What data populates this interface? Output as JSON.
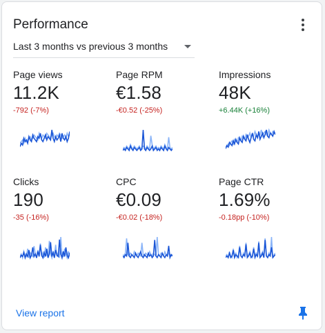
{
  "card": {
    "title": "Performance",
    "date_range": "Last 3 months vs previous 3 months",
    "footer_link": "View report",
    "icons": {
      "menu": "more-vert-icon",
      "dropdown": "arrow-drop-down-icon",
      "pin": "pin-icon"
    }
  },
  "colors": {
    "accent": "#1a73e8",
    "line_current": "#1a55d6",
    "line_previous": "#8ab4f8",
    "negative": "#c5221f",
    "positive": "#188038"
  },
  "metrics": [
    {
      "name": "Page views",
      "value": "11.2K",
      "change": "-792 (-7%)",
      "trend": "negative",
      "spark": {
        "current": [
          4,
          6,
          5,
          9,
          7,
          8,
          6,
          10,
          8,
          7,
          11,
          9,
          8,
          7,
          10,
          9,
          12,
          8,
          7,
          9,
          11,
          8,
          10,
          9,
          8,
          14,
          9,
          7,
          10,
          8,
          9,
          11,
          7,
          12,
          9,
          8,
          10,
          7,
          9,
          13
        ],
        "previous": [
          6,
          7,
          8,
          6,
          9,
          7,
          8,
          9,
          10,
          8,
          9,
          11,
          10,
          9,
          8,
          12,
          10,
          9,
          11,
          10,
          9,
          12,
          11,
          10,
          9,
          11,
          12,
          10,
          9,
          11,
          10,
          12,
          11,
          9,
          10,
          11,
          9,
          12,
          10,
          11
        ]
      }
    },
    {
      "name": "Page RPM",
      "value": "€1.58",
      "change": "-€0.52 (-25%)",
      "trend": "negative",
      "spark": {
        "current": [
          2,
          3,
          2,
          4,
          3,
          2,
          5,
          3,
          2,
          4,
          3,
          2,
          3,
          4,
          2,
          3,
          16,
          3,
          2,
          4,
          3,
          2,
          3,
          5,
          2,
          3,
          4,
          2,
          3,
          2,
          4,
          3,
          2,
          5,
          3,
          2,
          4,
          3,
          2,
          3
        ],
        "previous": [
          3,
          4,
          3,
          5,
          4,
          3,
          6,
          4,
          3,
          5,
          4,
          3,
          4,
          5,
          3,
          4,
          5,
          4,
          3,
          5,
          4,
          3,
          12,
          6,
          3,
          4,
          5,
          3,
          4,
          3,
          5,
          4,
          3,
          6,
          4,
          3,
          11,
          4,
          3,
          4
        ]
      }
    },
    {
      "name": "Impressions",
      "value": "48K",
      "change": "+6.44K (+16%)",
      "trend": "positive",
      "spark": {
        "current": [
          3,
          5,
          4,
          7,
          6,
          5,
          8,
          6,
          9,
          7,
          6,
          10,
          8,
          7,
          11,
          9,
          8,
          12,
          9,
          7,
          10,
          13,
          9,
          8,
          12,
          10,
          14,
          9,
          11,
          13,
          10,
          12,
          15,
          11,
          10,
          13,
          12,
          11,
          14,
          12
        ],
        "previous": [
          4,
          5,
          6,
          5,
          7,
          8,
          6,
          9,
          8,
          7,
          10,
          9,
          8,
          11,
          10,
          9,
          12,
          10,
          11,
          13,
          10,
          12,
          11,
          14,
          12,
          10,
          13,
          12,
          15,
          11,
          13,
          14,
          12,
          11,
          15,
          13,
          12,
          14,
          13,
          12
        ]
      }
    },
    {
      "name": "Clicks",
      "value": "190",
      "change": "-35 (-16%)",
      "trend": "negative",
      "spark": {
        "current": [
          2,
          4,
          3,
          6,
          2,
          5,
          3,
          8,
          2,
          4,
          10,
          3,
          5,
          2,
          7,
          3,
          12,
          4,
          2,
          6,
          3,
          9,
          2,
          5,
          14,
          3,
          6,
          2,
          8,
          4,
          3,
          16,
          5,
          2,
          7,
          3,
          10,
          4,
          2,
          6
        ],
        "previous": [
          3,
          5,
          2,
          7,
          4,
          3,
          9,
          2,
          6,
          4,
          3,
          11,
          5,
          2,
          8,
          4,
          13,
          3,
          6,
          2,
          10,
          4,
          3,
          15,
          5,
          2,
          7,
          4,
          12,
          3,
          6,
          2,
          18,
          4,
          3,
          9,
          5,
          2,
          7,
          3
        ]
      }
    },
    {
      "name": "CPC",
      "value": "€0.09",
      "change": "-€0.02 (-18%)",
      "trend": "negative",
      "spark": {
        "current": [
          3,
          2,
          4,
          3,
          12,
          3,
          2,
          4,
          3,
          2,
          5,
          3,
          2,
          4,
          6,
          3,
          2,
          4,
          3,
          2,
          5,
          3,
          4,
          2,
          3,
          14,
          3,
          2,
          4,
          3,
          2,
          5,
          3,
          2,
          4,
          3,
          10,
          2,
          4,
          3
        ],
        "previous": [
          4,
          3,
          5,
          15,
          4,
          3,
          5,
          4,
          3,
          6,
          4,
          3,
          5,
          4,
          3,
          12,
          4,
          3,
          5,
          4,
          3,
          6,
          4,
          3,
          5,
          4,
          3,
          16,
          4,
          3,
          5,
          4,
          3,
          6,
          4,
          3,
          5,
          4,
          3,
          4
        ]
      }
    },
    {
      "name": "Page CTR",
      "value": "1.69%",
      "change": "-0.18pp (-10%)",
      "trend": "negative",
      "spark": {
        "current": [
          2,
          3,
          2,
          5,
          2,
          3,
          7,
          2,
          4,
          3,
          2,
          9,
          3,
          2,
          4,
          3,
          11,
          2,
          3,
          5,
          2,
          3,
          8,
          2,
          4,
          3,
          12,
          2,
          3,
          5,
          2,
          14,
          3,
          2,
          4,
          3,
          9,
          2,
          3,
          4
        ],
        "previous": [
          3,
          4,
          2,
          6,
          3,
          2,
          8,
          3,
          5,
          2,
          4,
          10,
          3,
          2,
          5,
          3,
          12,
          2,
          4,
          6,
          3,
          2,
          9,
          3,
          5,
          2,
          13,
          3,
          4,
          6,
          2,
          15,
          3,
          2,
          5,
          3,
          16,
          2,
          4,
          5
        ]
      }
    }
  ]
}
